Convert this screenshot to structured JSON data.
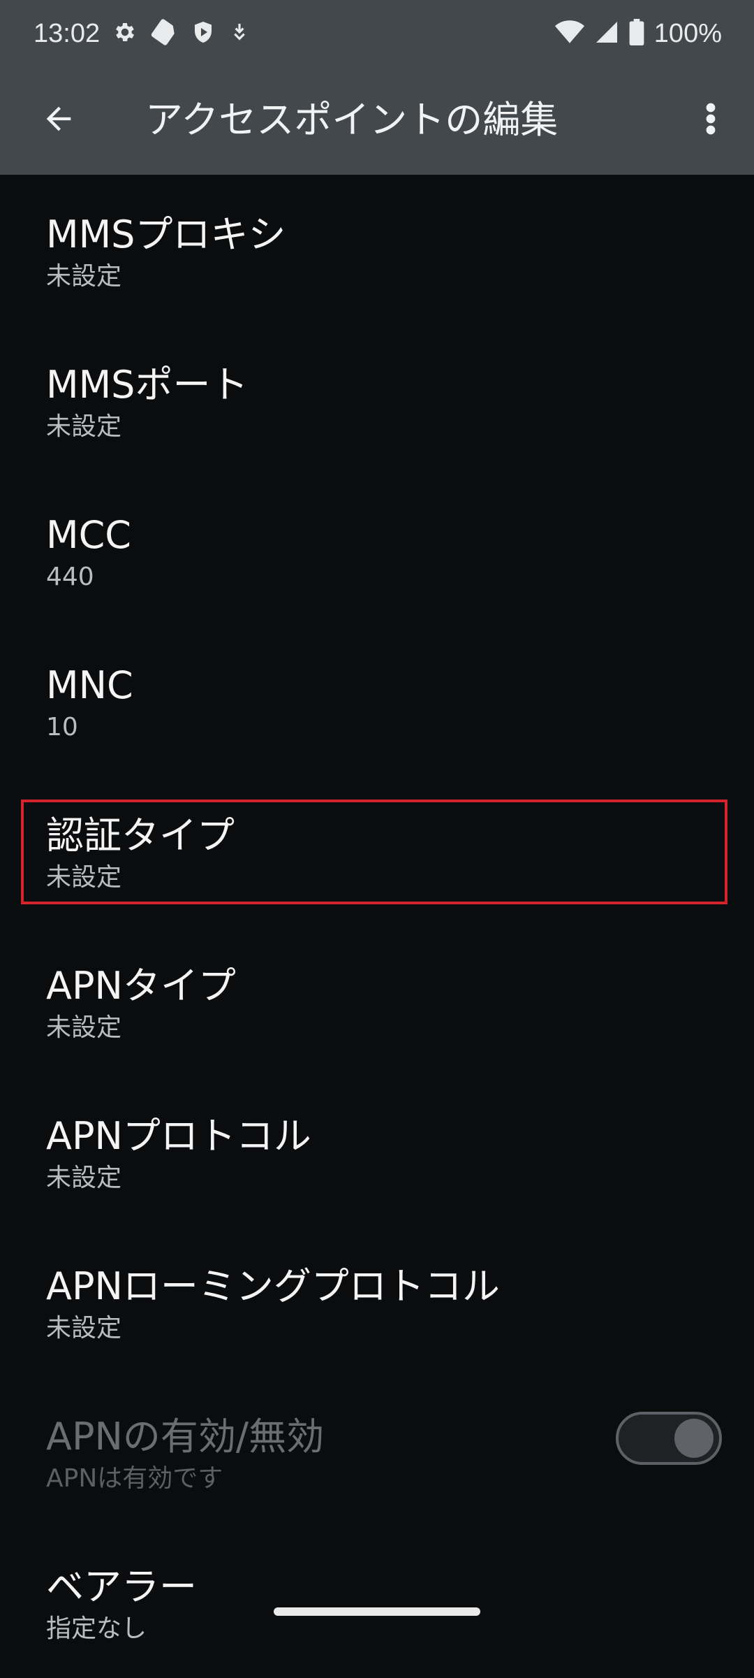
{
  "status_bar": {
    "time": "13:02",
    "left_icons": [
      "gear-icon",
      "sim-card-icon",
      "shield-icon",
      "download-icon"
    ],
    "battery_text": "100%",
    "right_icons": [
      "wifi-icon",
      "cell-signal-icon",
      "battery-icon"
    ]
  },
  "app_bar": {
    "title": "アクセスポイントの編集",
    "back_icon": "arrow-left-icon",
    "overflow_icon": "more-vert-icon"
  },
  "items": [
    {
      "title": "MMSプロキシ",
      "summary": "未設定"
    },
    {
      "title": "MMSポート",
      "summary": "未設定"
    },
    {
      "title": "MCC",
      "summary": "440"
    },
    {
      "title": "MNC",
      "summary": "10"
    },
    {
      "title": "認証タイプ",
      "summary": "未設定"
    },
    {
      "title": "APNタイプ",
      "summary": "未設定"
    },
    {
      "title": "APNプロトコル",
      "summary": "未設定"
    },
    {
      "title": "APNローミングプロトコル",
      "summary": "未設定"
    },
    {
      "title": "APNの有効/無効",
      "summary": "APNは有効です"
    },
    {
      "title": "ベアラー",
      "summary": "指定なし"
    }
  ],
  "toggle": {
    "state": "on",
    "enabled": false
  },
  "colors": {
    "header_bg": "#43484d",
    "page_bg": "#0b0c0e",
    "highlight": "#d3242e"
  }
}
